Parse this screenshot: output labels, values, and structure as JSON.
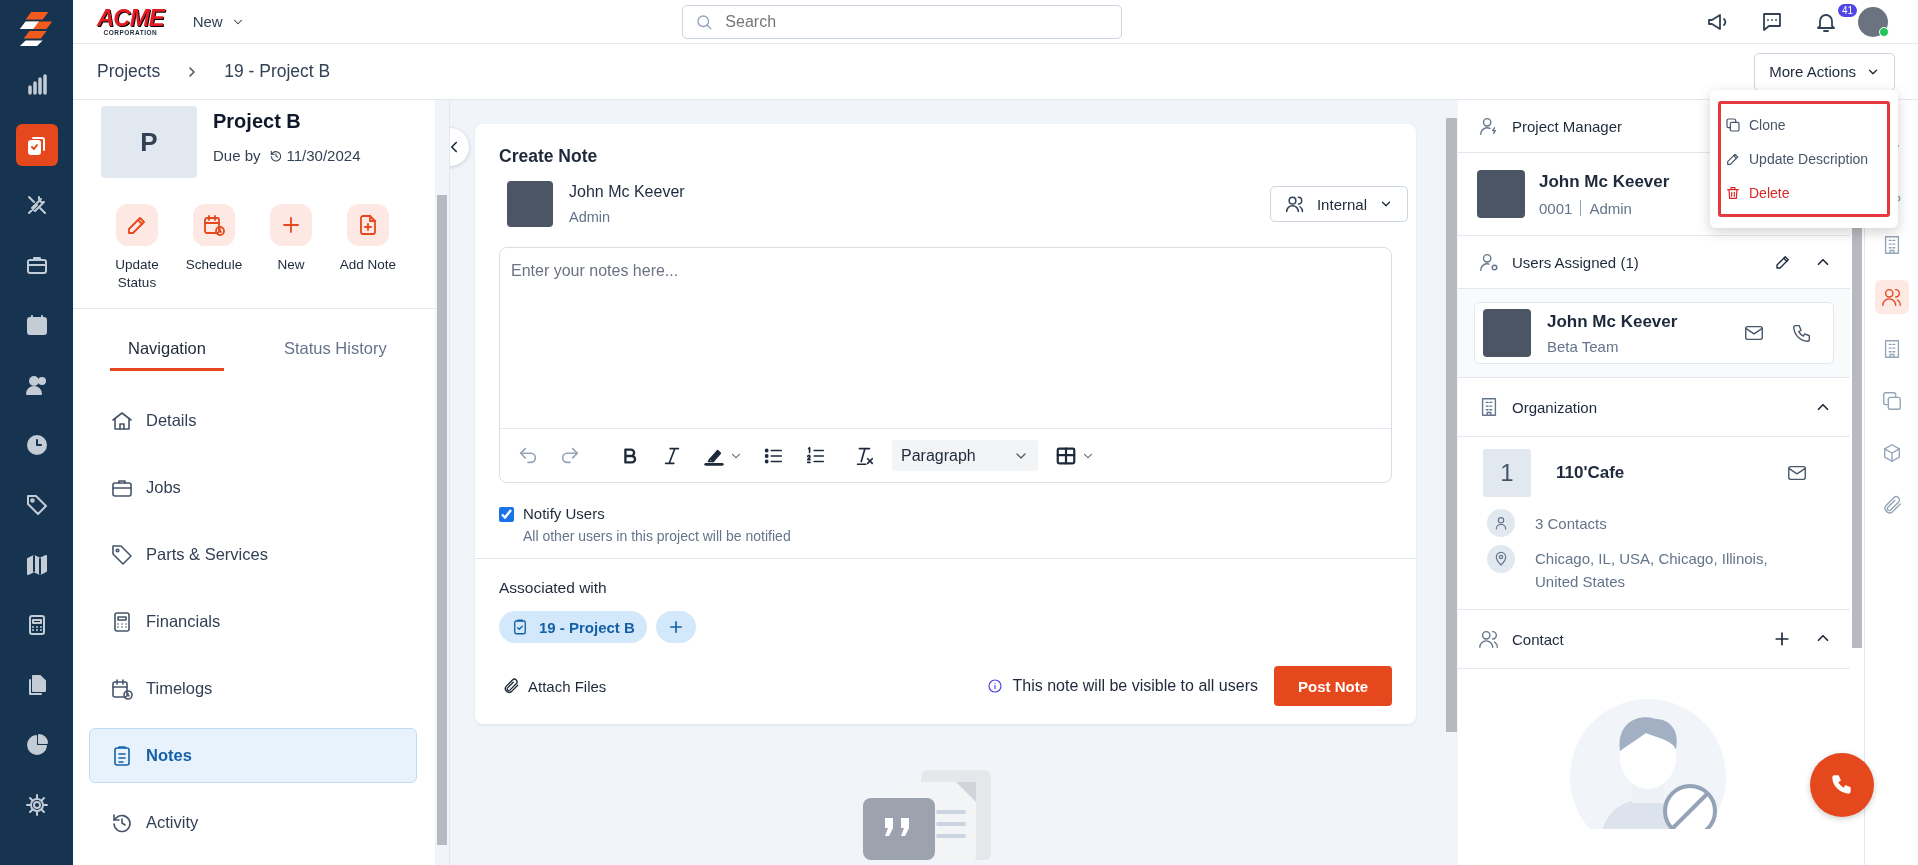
{
  "app_rail": {
    "items": [
      {
        "selected": false
      },
      {
        "selected": true
      },
      {
        "selected": false
      },
      {
        "selected": false
      },
      {
        "selected": false
      },
      {
        "selected": false
      },
      {
        "selected": false
      },
      {
        "selected": false
      },
      {
        "selected": false
      },
      {
        "selected": false
      },
      {
        "selected": false
      },
      {
        "selected": false
      },
      {
        "selected": false
      }
    ]
  },
  "top_bar": {
    "logo": {
      "title": "ACME",
      "subtitle": "CORPORATION"
    },
    "new_menu": "New",
    "search": {
      "placeholder": "Search"
    },
    "notification_count": "41",
    "user": {
      "online": true
    }
  },
  "breadcrumb": {
    "items": [
      "Projects",
      "19 - Project B"
    ],
    "more_actions": "More Actions"
  },
  "actions_menu": {
    "items": [
      {
        "label": "Clone",
        "kind": "normal"
      },
      {
        "label": "Update Description",
        "kind": "normal"
      },
      {
        "label": "Delete",
        "kind": "danger"
      }
    ]
  },
  "project": {
    "initial": "P",
    "name": "Project B",
    "due_label": "Due by",
    "due_date": "11/30/2024",
    "quick_actions": [
      "Update Status",
      "Schedule",
      "New",
      "Add Note"
    ],
    "tabs": [
      {
        "label": "Navigation",
        "selected": true
      },
      {
        "label": "Status History",
        "selected": false
      }
    ],
    "nav": [
      {
        "label": "Details",
        "selected": false
      },
      {
        "label": "Jobs",
        "selected": false
      },
      {
        "label": "Parts & Services",
        "selected": false
      },
      {
        "label": "Financials",
        "selected": false
      },
      {
        "label": "Timelogs",
        "selected": false
      },
      {
        "label": "Notes",
        "selected": true
      },
      {
        "label": "Activity",
        "selected": false
      }
    ]
  },
  "note": {
    "title": "Create Note",
    "author": {
      "name": "John Mc Keever",
      "role": "Admin"
    },
    "visibility": "Internal",
    "editor": {
      "placeholder": "Enter your notes here...",
      "block_format": "Paragraph"
    },
    "notify": {
      "label": "Notify Users",
      "hint": "All other users in this project will be notified",
      "checked": true
    },
    "associated": {
      "title": "Associated with",
      "tags": [
        "19 - Project B"
      ]
    },
    "attach": "Attach Files",
    "visibility_note": "This note will be visible to all users",
    "post": "Post Note"
  },
  "side": {
    "manager": {
      "title": "Project Manager",
      "name": "John Mc Keever",
      "id": "0001",
      "role": "Admin"
    },
    "assigned": {
      "title": "Users Assigned (1)",
      "users": [
        {
          "name": "John Mc Keever",
          "team": "Beta Team"
        }
      ]
    },
    "organization": {
      "title": "Organization",
      "initial": "1",
      "name": "110'Cafe",
      "contacts": "3 Contacts",
      "address": "Chicago, IL, USA, Chicago, Illinois, United States"
    },
    "contact": {
      "title": "Contact"
    }
  },
  "icon_rail": {
    "items": [
      {
        "selected": false
      },
      {
        "selected": false
      },
      {
        "selected": false
      },
      {
        "selected": true
      },
      {
        "selected": false
      },
      {
        "selected": false
      },
      {
        "selected": false
      },
      {
        "selected": false
      }
    ]
  }
}
